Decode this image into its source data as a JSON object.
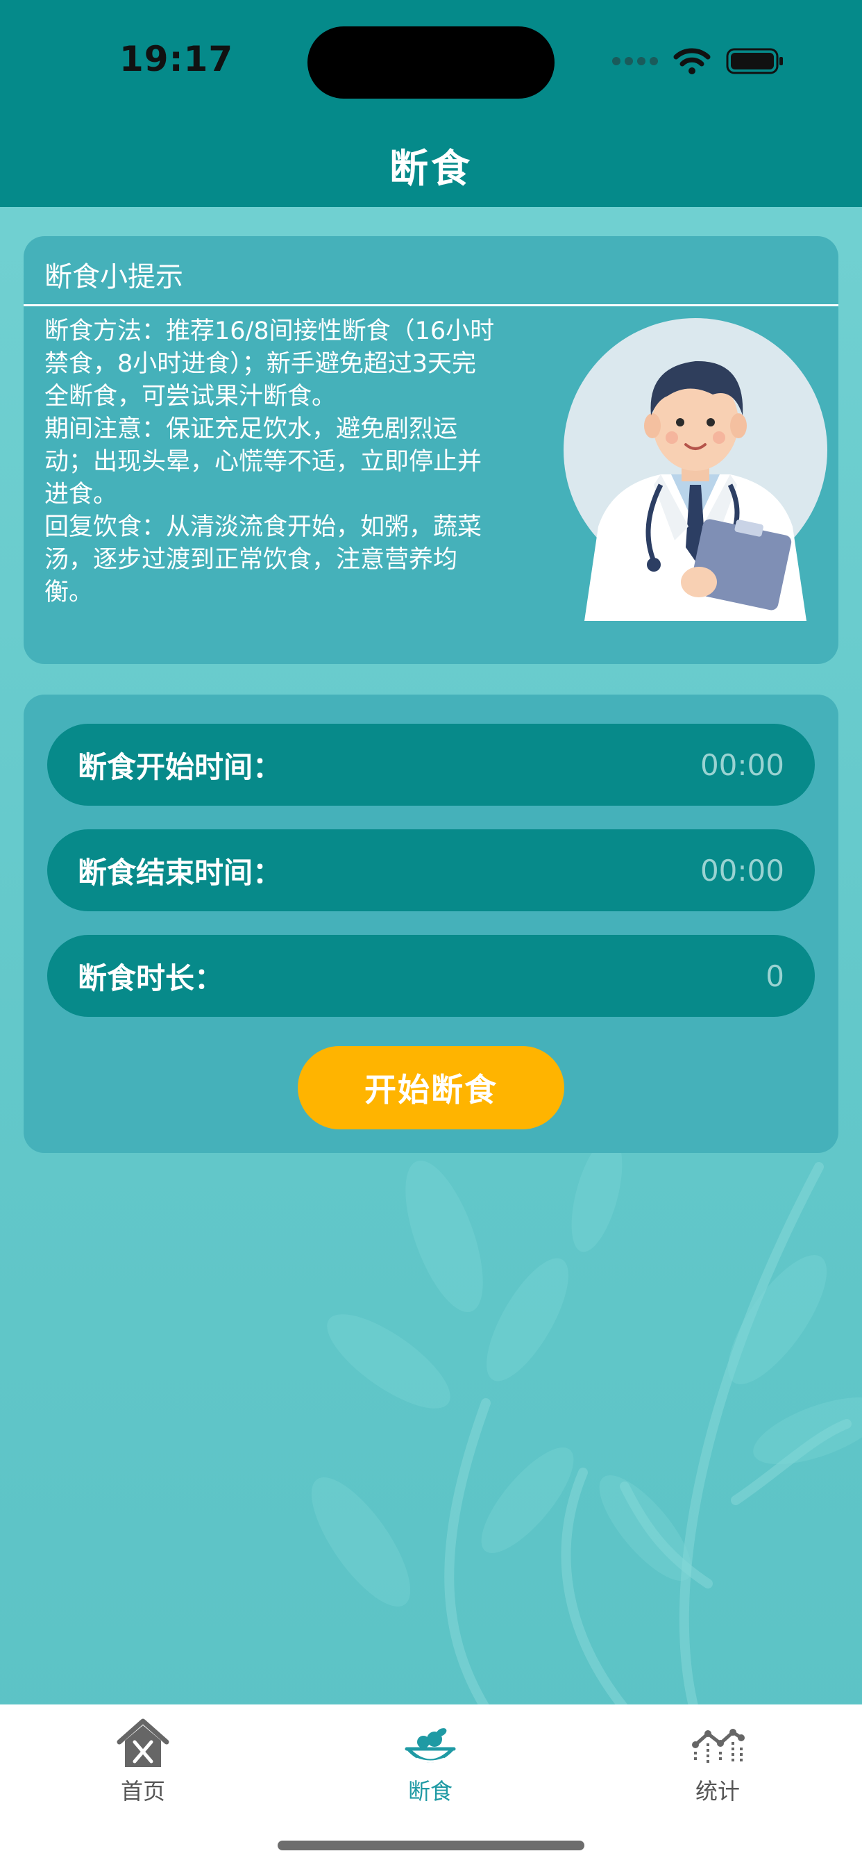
{
  "status_bar": {
    "time": "19:17"
  },
  "header": {
    "title": "断食"
  },
  "tips": {
    "title": "断食小提示",
    "lines": [
      "断食方法：推荐16/8间接性断食（16小时",
      "禁食，8小时进食）；新手避免超过3天完",
      "全断食，可尝试果汁断食。",
      "期间注意：保证充足饮水，避免剧烈运",
      "动；出现头晕，心慌等不适，立即停止并",
      "进食。",
      "回复饮食：从清淡流食开始，如粥，蔬菜",
      "汤，逐步过渡到正常饮食，注意营养均",
      "衡。"
    ],
    "illustration": "doctor-illustration"
  },
  "form": {
    "start_label": "断食开始时间：",
    "start_value": "00:00",
    "end_label": "断食结束时间：",
    "end_value": "00:00",
    "duration_label": "断食时长：",
    "duration_value": "0",
    "button_label": "开始断食"
  },
  "tabs": [
    {
      "label": "首页",
      "icon": "home-icon",
      "active": false
    },
    {
      "label": "断食",
      "icon": "fasting-bowl-icon",
      "active": true
    },
    {
      "label": "统计",
      "icon": "stats-chart-icon",
      "active": false
    }
  ],
  "colors": {
    "header_bg": "#058a8a",
    "card_bg": "#45b1ba",
    "field_bg": "#078a8a",
    "button_bg": "#ffb400",
    "active_tab": "#1f9aa4"
  }
}
